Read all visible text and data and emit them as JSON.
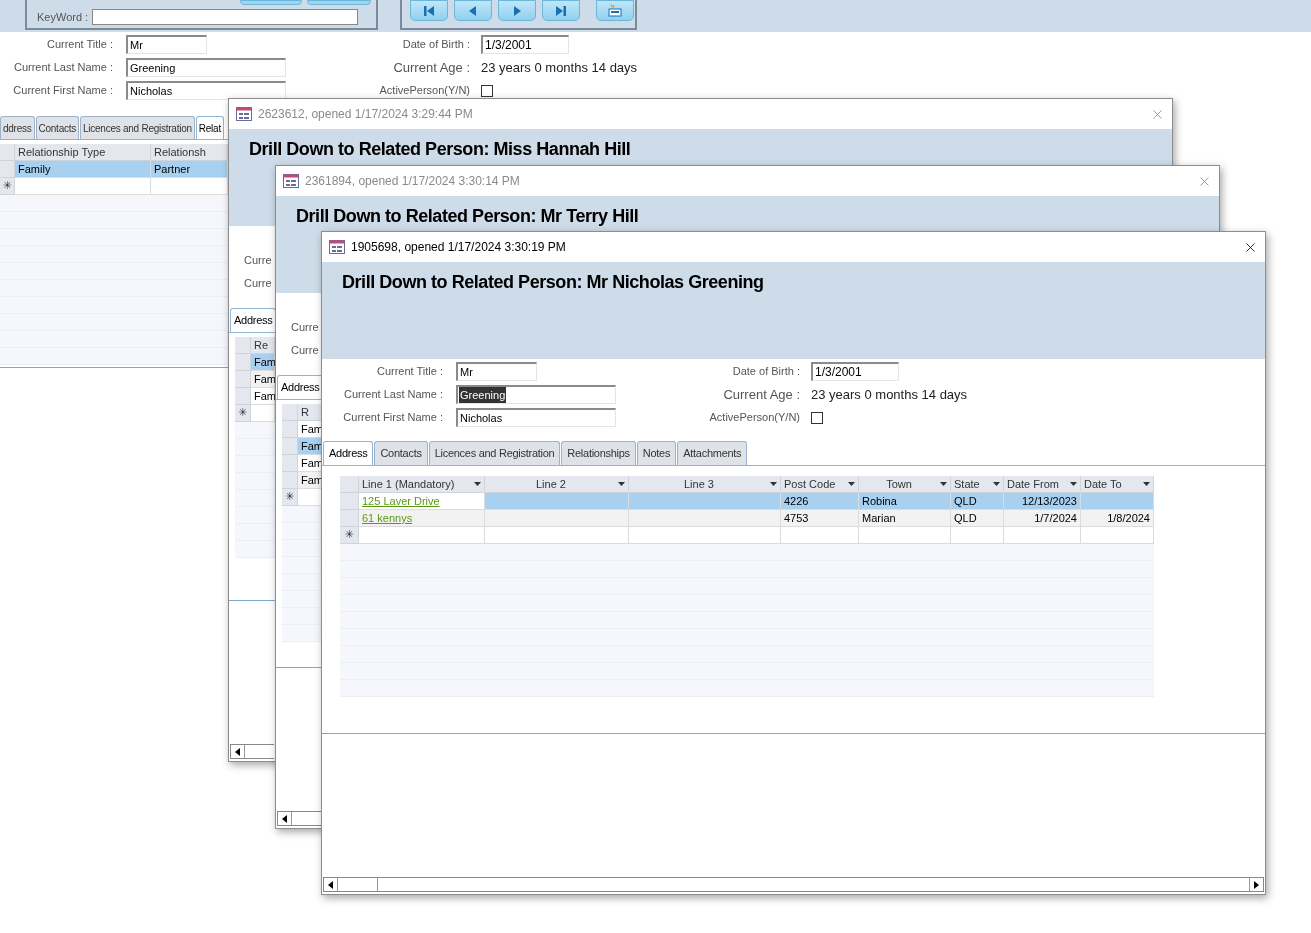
{
  "main_form": {
    "keyword_label": "KeyWord :",
    "left_fields": [
      {
        "label": "Current Title :",
        "value": "Mr",
        "highlighted": false
      },
      {
        "label": "Current Last Name :",
        "value": "Greening",
        "highlighted": false
      },
      {
        "label": "Current First Name :",
        "value": "Nicholas",
        "highlighted": false
      }
    ],
    "right_fields": [
      {
        "kind": "field",
        "label": "Date of Birth :",
        "value": "1/3/2001"
      },
      {
        "kind": "text",
        "label": "Current Age :",
        "value": "23 years 0 months 14 days"
      },
      {
        "kind": "checkbox",
        "label": "ActivePerson(Y/N)",
        "checked": false
      }
    ],
    "tabs": [
      {
        "label": "ddress",
        "selected": false
      },
      {
        "label": "Contacts",
        "selected": false
      },
      {
        "label": "Licences and Registration",
        "selected": false
      },
      {
        "label": "Relat",
        "selected": true
      }
    ],
    "grid": {
      "columns": [
        "Relationship Type",
        "Relationsh"
      ],
      "rows": [
        {
          "cells": [
            "Family",
            "Partner"
          ],
          "selected": true
        }
      ],
      "new_row_marker": "✳"
    }
  },
  "windows": [
    {
      "kind": "back",
      "active": false,
      "title": "2623612, opened 1/17/2024 3:29:44 PM",
      "heading": "Drill Down to Related Person: Miss Hannah Hill",
      "labels": [
        "Curre",
        "Curre"
      ],
      "tabs": [
        {
          "label": "Address",
          "selected": true
        }
      ],
      "grid": {
        "columns": [
          "Re"
        ],
        "rows": [
          {
            "cells": [
              "Fam"
            ],
            "selected": true
          },
          {
            "cells": [
              "Fam"
            ],
            "selected": false
          },
          {
            "cells": [
              "Fam"
            ],
            "selected": false
          }
        ],
        "new_row_marker": "✳"
      }
    },
    {
      "kind": "back",
      "active": false,
      "title": "2361894, opened 1/17/2024 3:30:14 PM",
      "heading": "Drill Down to Related Person: Mr Terry Hill",
      "labels": [
        "Curre",
        "Curre"
      ],
      "tabs": [
        {
          "label": "Address",
          "selected": true
        }
      ],
      "grid": {
        "columns": [
          "R"
        ],
        "rows": [
          {
            "cells": [
              "Fam"
            ],
            "selected": false
          },
          {
            "cells": [
              "Fam"
            ],
            "selected": true
          },
          {
            "cells": [
              "Fam"
            ],
            "selected": false
          },
          {
            "cells": [
              "Fam"
            ],
            "selected": false
          }
        ],
        "new_row_marker": "✳"
      }
    },
    {
      "kind": "front",
      "active": true,
      "title": "1905698, opened 1/17/2024 3:30:19 PM",
      "heading": "Drill Down to Related Person: Mr Nicholas Greening",
      "left_fields": [
        {
          "label": "Current Title :",
          "value": "Mr",
          "highlighted": false
        },
        {
          "label": "Current Last Name :",
          "value": "Greening",
          "highlighted": true
        },
        {
          "label": "Current First Name :",
          "value": "Nicholas",
          "highlighted": false
        }
      ],
      "right_fields": [
        {
          "kind": "field",
          "label": "Date of Birth :",
          "value": "1/3/2001"
        },
        {
          "kind": "text",
          "label": "Current Age :",
          "value": "23 years 0 months 14 days"
        },
        {
          "kind": "checkbox",
          "label": "ActivePerson(Y/N)",
          "checked": false
        }
      ],
      "tabs": [
        {
          "label": "Address",
          "selected": true
        },
        {
          "label": "Contacts",
          "selected": false
        },
        {
          "label": "Licences and Registration",
          "selected": false
        },
        {
          "label": "Relationships",
          "selected": false
        },
        {
          "label": "Notes",
          "selected": false
        },
        {
          "label": "Attachments",
          "selected": false
        }
      ],
      "grid": {
        "columns": [
          "Line 1 (Mandatory)",
          "Line 2",
          "Line 3",
          "Post Code",
          "Town",
          "State",
          "Date From",
          "Date To"
        ],
        "rows": [
          {
            "cells": [
              "125 Laver Drive",
              "",
              "",
              "4226",
              "Robina",
              "QLD",
              "12/13/2023",
              ""
            ],
            "selected": true
          },
          {
            "cells": [
              "61 kennys",
              "",
              "",
              "4753",
              "Marian",
              "QLD",
              "1/7/2024",
              "1/8/2024"
            ],
            "selected": false
          }
        ],
        "new_row_marker": "✳"
      }
    }
  ]
}
